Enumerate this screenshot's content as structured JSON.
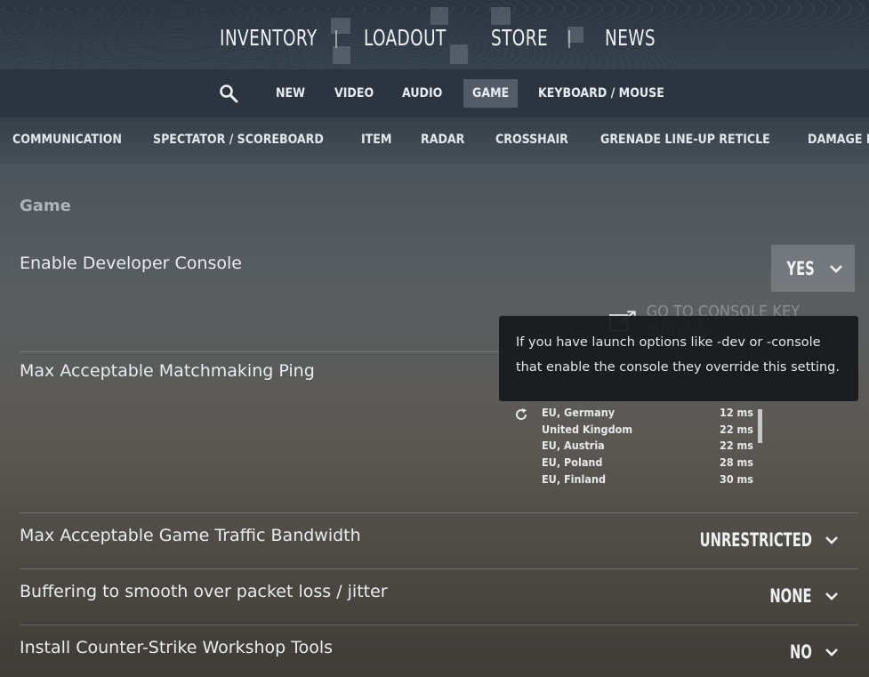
{
  "top_nav": {
    "items": [
      "INVENTORY",
      "LOADOUT",
      "STORE",
      "NEWS"
    ]
  },
  "sub_nav": {
    "items": [
      "NEW",
      "VIDEO",
      "AUDIO",
      "GAME",
      "KEYBOARD / MOUSE"
    ],
    "active": "GAME"
  },
  "categories": [
    "COMMUNICATION",
    "SPECTATOR / SCOREBOARD",
    "ITEM",
    "RADAR",
    "CROSSHAIR",
    "GRENADE LINE-UP RETICLE",
    "DAMAGE PREDICTION"
  ],
  "section_title": "Game",
  "settings": {
    "dev_console": {
      "label": "Enable Developer Console",
      "value": "YES"
    },
    "console_link": "GO TO CONSOLE KEY BINDING",
    "matchmaking_ping": {
      "label": "Max Acceptable Matchmaking Ping"
    },
    "bandwidth": {
      "label": "Max Acceptable Game Traffic Bandwidth",
      "value": "UNRESTRICTED"
    },
    "buffering": {
      "label": "Buffering to smooth over packet loss / jitter",
      "value": "NONE"
    },
    "workshop": {
      "label": "Install Counter-Strike Workshop Tools",
      "value": "NO"
    }
  },
  "tooltip": {
    "line1": "If you have launch options like -dev or -console",
    "line2": "that enable the console they override this setting."
  },
  "ping_list": [
    {
      "region": "EU, Germany",
      "ping": "12 ms"
    },
    {
      "region": "United Kingdom",
      "ping": "22 ms"
    },
    {
      "region": "EU, Austria",
      "ping": "22 ms"
    },
    {
      "region": "EU, Poland",
      "ping": "28 ms"
    },
    {
      "region": "EU, Finland",
      "ping": "30 ms"
    }
  ],
  "icons": {
    "search": "search-icon",
    "chevron": "chevron-down-icon",
    "refresh": "refresh-icon",
    "external": "external-link-icon"
  }
}
